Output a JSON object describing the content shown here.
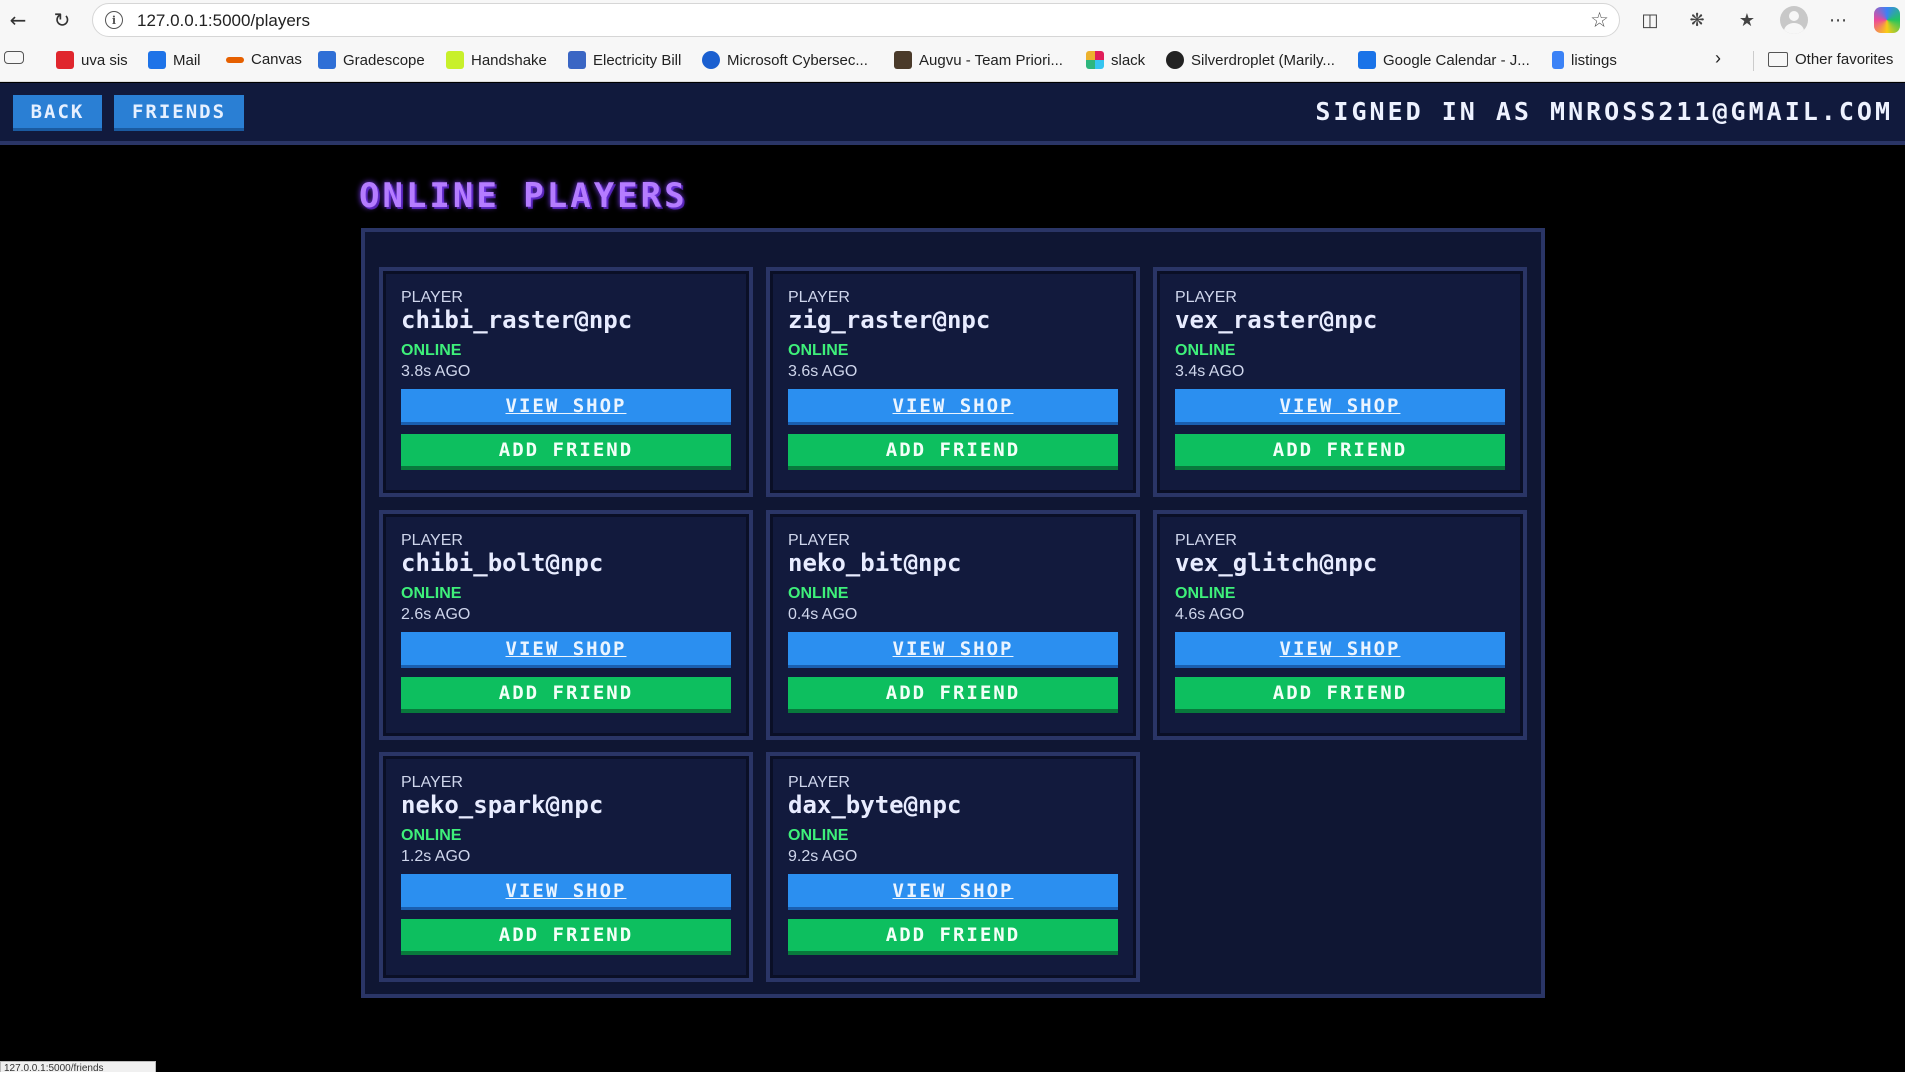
{
  "browser": {
    "url": "127.0.0.1:5000/players",
    "status_url": "127.0.0.1:5000/friends",
    "bookmarks": [
      {
        "label": "uva sis",
        "color": "#e0262d"
      },
      {
        "label": "Mail",
        "color": "#1e73e8"
      },
      {
        "label": "Canvas",
        "color": "#e66000"
      },
      {
        "label": "Gradescope",
        "color": "#2f6fd6"
      },
      {
        "label": "Handshake",
        "color": "#c8f02a"
      },
      {
        "label": "Electricity Bill",
        "color": "#3a66c4"
      },
      {
        "label": "Microsoft Cybersec...",
        "color": "#1a5fd0"
      },
      {
        "label": "Augvu - Team Priori...",
        "color": "#4a3a2a"
      },
      {
        "label": "slack",
        "color": "#e01e5a"
      },
      {
        "label": "Silverdroplet (Marily...",
        "color": "#222222"
      },
      {
        "label": "Google Calendar - J...",
        "color": "#1a73e8"
      },
      {
        "label": "listings",
        "color": "#3b82f6"
      }
    ],
    "other_favorites": "Other favorites"
  },
  "header": {
    "back_label": "BACK",
    "friends_label": "FRIENDS",
    "signed_in": "SIGNED IN AS MNROSS211@GMAIL.COM"
  },
  "page": {
    "title": "ONLINE PLAYERS"
  },
  "players": [
    {
      "label": "PLAYER",
      "name": "chibi_raster@npc",
      "status": "ONLINE",
      "ago": "3.8s AGO",
      "shop_label": "VIEW SHOP",
      "add_label": "ADD FRIEND"
    },
    {
      "label": "PLAYER",
      "name": "zig_raster@npc",
      "status": "ONLINE",
      "ago": "3.6s AGO",
      "shop_label": "VIEW SHOP",
      "add_label": "ADD FRIEND"
    },
    {
      "label": "PLAYER",
      "name": "vex_raster@npc",
      "status": "ONLINE",
      "ago": "3.4s AGO",
      "shop_label": "VIEW SHOP",
      "add_label": "ADD FRIEND"
    },
    {
      "label": "PLAYER",
      "name": "chibi_bolt@npc",
      "status": "ONLINE",
      "ago": "2.6s AGO",
      "shop_label": "VIEW SHOP",
      "add_label": "ADD FRIEND"
    },
    {
      "label": "PLAYER",
      "name": "neko_bit@npc",
      "status": "ONLINE",
      "ago": "0.4s AGO",
      "shop_label": "VIEW SHOP",
      "add_label": "ADD FRIEND"
    },
    {
      "label": "PLAYER",
      "name": "vex_glitch@npc",
      "status": "ONLINE",
      "ago": "4.6s AGO",
      "shop_label": "VIEW SHOP",
      "add_label": "ADD FRIEND"
    },
    {
      "label": "PLAYER",
      "name": "neko_spark@npc",
      "status": "ONLINE",
      "ago": "1.2s AGO",
      "shop_label": "VIEW SHOP",
      "add_label": "ADD FRIEND"
    },
    {
      "label": "PLAYER",
      "name": "dax_byte@npc",
      "status": "ONLINE",
      "ago": "9.2s AGO",
      "shop_label": "VIEW SHOP",
      "add_label": "ADD FRIEND"
    }
  ]
}
